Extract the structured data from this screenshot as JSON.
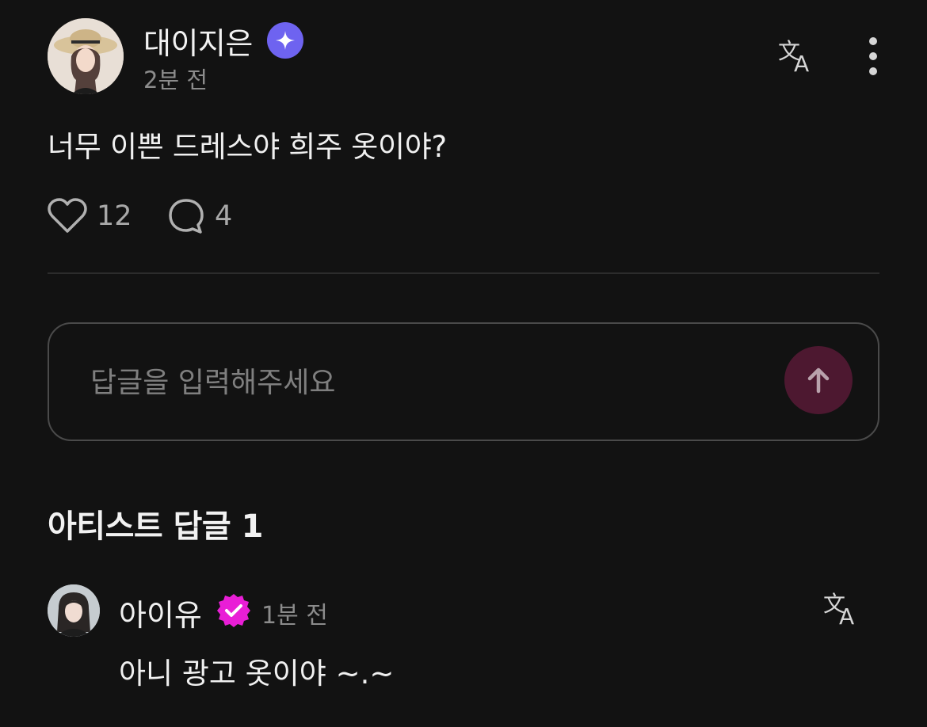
{
  "post": {
    "author": "대이지은",
    "time": "2분 전",
    "body": "너무 이쁜 드레스야 희주 옷이야?",
    "likes": "12",
    "comments": "4"
  },
  "reply_input": {
    "placeholder": "답글을 입력해주세요"
  },
  "artist_replies": {
    "title": "아티스트 답글 1",
    "items": [
      {
        "author": "아이유",
        "time": "1분 전",
        "body": "아니 광고 옷이야 ~.~"
      }
    ]
  },
  "icons": {
    "fan_badge": "sparkle-badge-icon",
    "verified": "verified-badge-icon",
    "translate": "translate-icon",
    "more": "more-vertical-icon",
    "like": "heart-icon",
    "comment": "comment-icon",
    "send": "arrow-up-icon"
  },
  "colors": {
    "background": "#121212",
    "fan_badge": "#6e63f0",
    "verified_badge": "#e91ed6",
    "send_button": "#4d1830"
  }
}
